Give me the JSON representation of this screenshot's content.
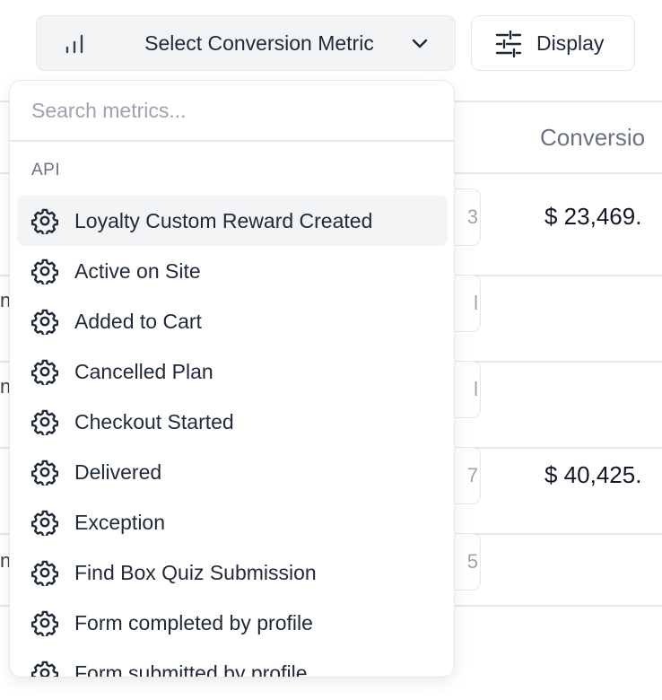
{
  "toolbar": {
    "metric_button_label": "Select Conversion Metric",
    "display_button_label": "Display"
  },
  "table": {
    "column_header": "Conversio",
    "amounts": [
      "$ 23,469.",
      "$ 40,425."
    ],
    "partial_cells": [
      "3",
      "l",
      "l",
      "7",
      "5"
    ],
    "left_glyphs": [
      "n",
      "n",
      "n"
    ]
  },
  "dropdown": {
    "search_placeholder": "Search metrics...",
    "group_label": "API",
    "items": [
      {
        "label": "Loyalty Custom Reward Created",
        "icon": "gear-icon",
        "highlighted": true
      },
      {
        "label": "Active on Site",
        "icon": "gear-icon"
      },
      {
        "label": "Added to Cart",
        "icon": "gear-icon"
      },
      {
        "label": "Cancelled Plan",
        "icon": "gear-icon"
      },
      {
        "label": "Checkout Started",
        "icon": "gear-icon"
      },
      {
        "label": "Delivered",
        "icon": "gear-icon"
      },
      {
        "label": "Exception",
        "icon": "gear-icon"
      },
      {
        "label": "Find Box Quiz Submission",
        "icon": "gear-icon"
      },
      {
        "label": "Form completed by profile",
        "icon": "gear-icon"
      },
      {
        "label": "Form submitted by profile",
        "icon": "gear-icon"
      }
    ]
  },
  "colors": {
    "border": "#e5e7eb",
    "muted_text": "#6b7280",
    "highlight_bg": "#f3f4f6"
  }
}
